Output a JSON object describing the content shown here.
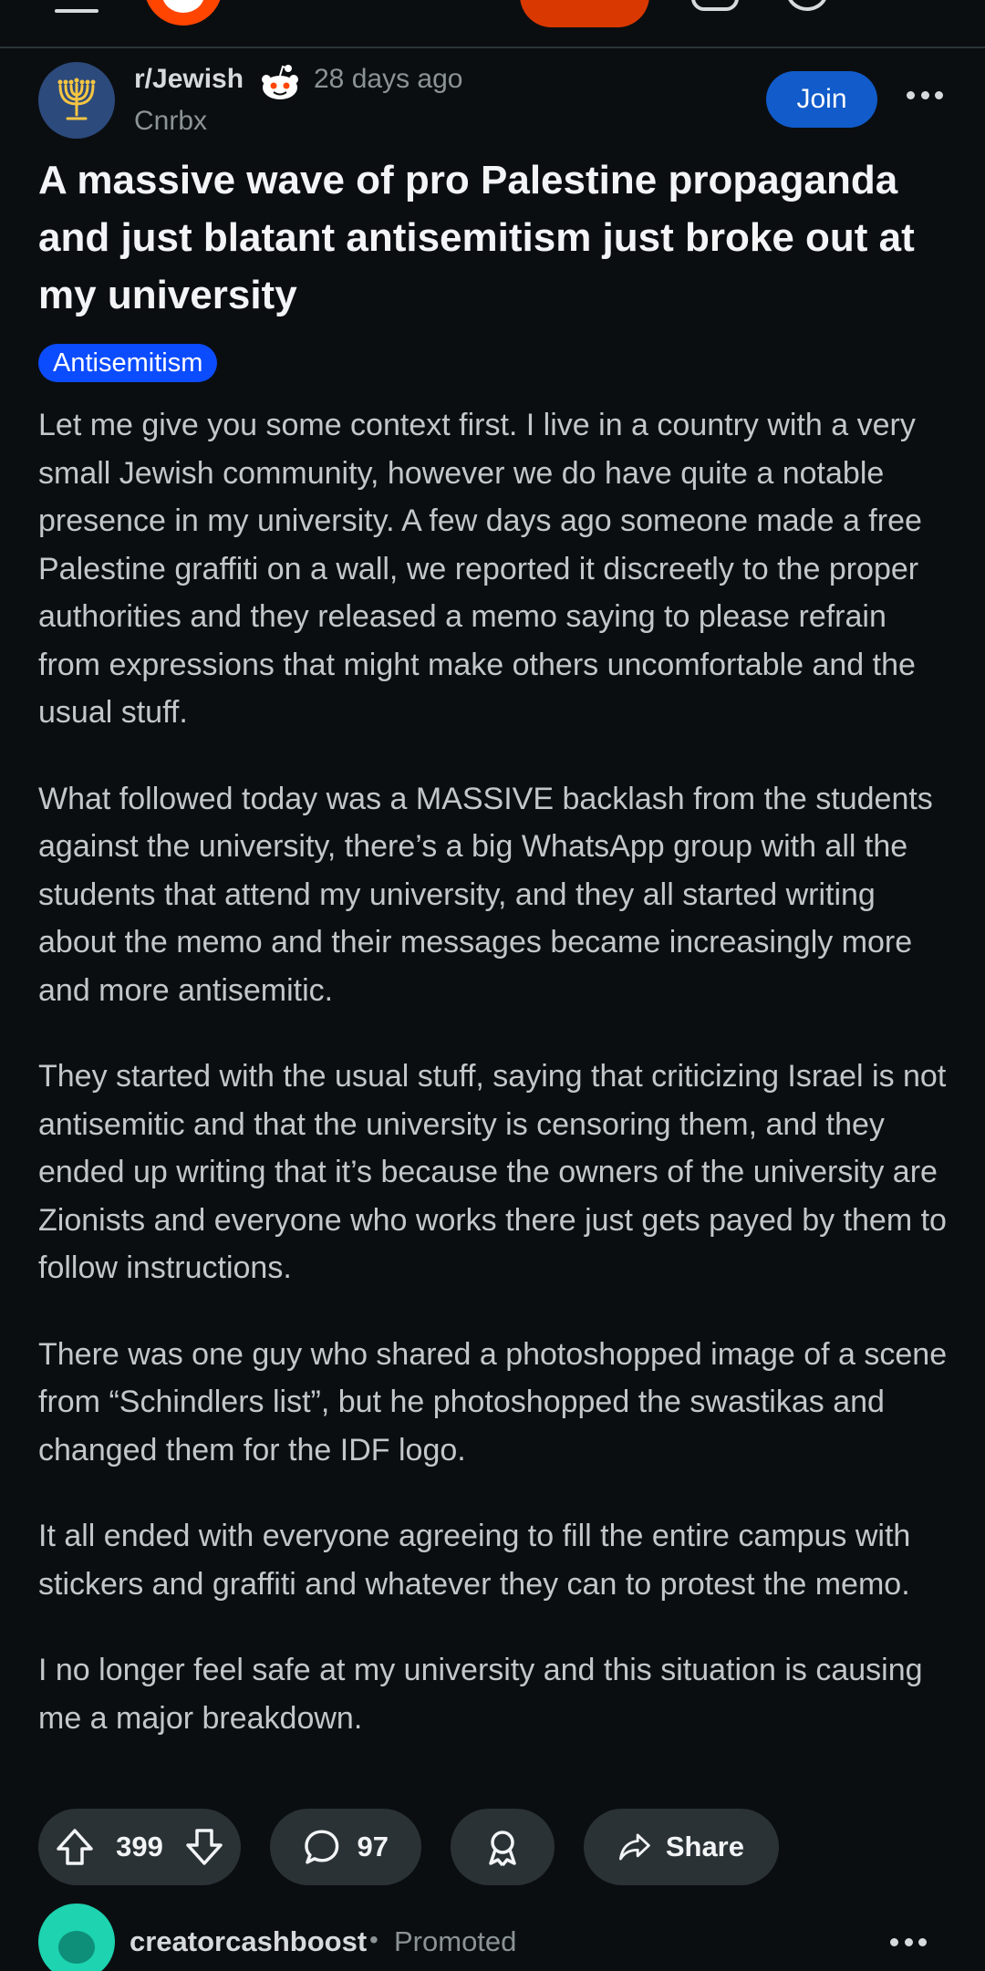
{
  "post": {
    "subreddit": "r/Jewish",
    "time": "28 days ago",
    "author": "Cnrbx",
    "join_label": "Join",
    "title": "A massive wave of pro Palestine propaganda and just blatant antisemitism just broke out at my university",
    "flair": "Antisemitism",
    "paragraphs": [
      "Let me give you some context first. I live in a country with a very small Jewish community, however we do have quite a notable presence in my university. A few days ago someone made a free Palestine graffiti on a wall, we reported it discreetly to the proper authorities and they released a memo saying to please refrain from expressions that might make others uncomfortable and the usual stuff.",
      "What followed today was a MASSIVE backlash from the students against the university, there’s a big WhatsApp group with all the students that attend my university, and they all started writing about the memo and their messages became increasingly more and more antisemitic.",
      "They started with the usual stuff, saying that criticizing Israel is not antisemitic and that the university is censoring them, and they ended up writing that it’s because the owners of the university are Zionists and everyone who works there just gets payed by them to follow instructions.",
      "There was one guy who shared a photoshopped image of a scene from “Schindlers list”, but he photoshopped the swastikas and changed them for the IDF logo.",
      "It all ended with everyone agreeing to fill the entire campus with stickers and graffiti and whatever they can to protest the memo.",
      "I no longer feel safe at my university and this situation is causing me a major breakdown."
    ],
    "votes": "399",
    "comments": "97",
    "share_label": "Share"
  },
  "promoted": {
    "name": "creatorcashboost",
    "separator": "•",
    "label": "Promoted"
  },
  "colors": {
    "background": "#0b0e11",
    "join": "#115bca",
    "flair": "#0c4cff",
    "pill": "#2a3236"
  },
  "icons": [
    "menu-icon",
    "reddit-logo",
    "chat-icon",
    "search-icon",
    "menorah-icon",
    "snoo-icon",
    "more-icon",
    "upvote-icon",
    "downvote-icon",
    "comment-icon",
    "award-icon",
    "share-icon"
  ]
}
